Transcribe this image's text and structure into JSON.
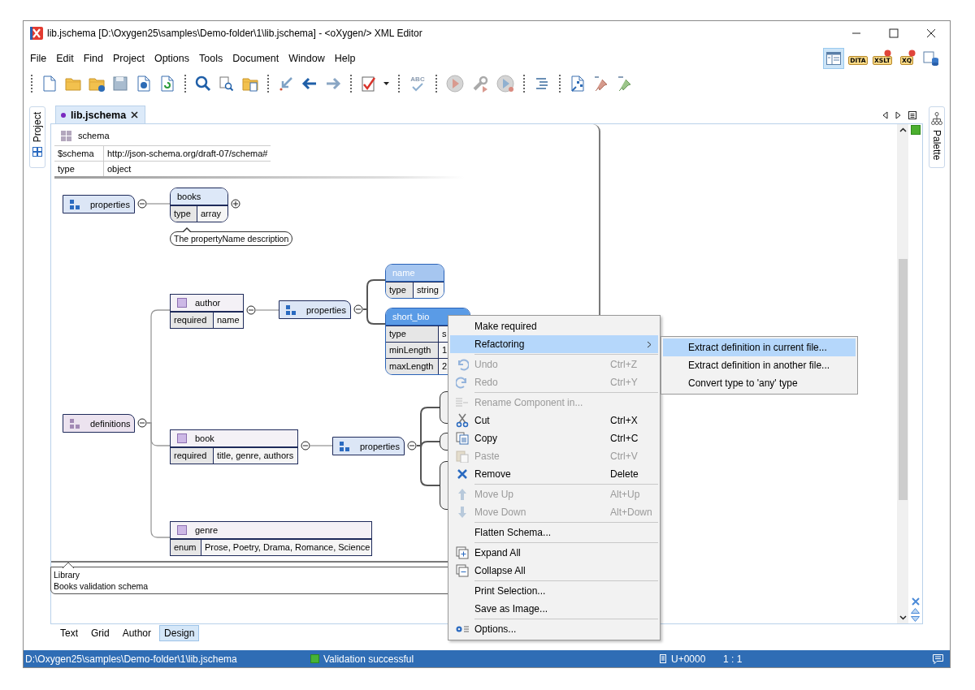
{
  "window": {
    "title": "lib.jschema [D:\\Oxygen25\\samples\\Demo-folder\\1\\lib.jschema] - <oXygen/> XML Editor"
  },
  "menu_bar": [
    "File",
    "Edit",
    "Find",
    "Project",
    "Options",
    "Tools",
    "Document",
    "Window",
    "Help"
  ],
  "perspectives": [
    {
      "kind": "editor",
      "selected": true
    },
    {
      "kind": "badge",
      "label": "DITA",
      "selected": false
    },
    {
      "kind": "debug-badge",
      "label": "XSLT",
      "selected": false
    },
    {
      "kind": "debug-badge",
      "label": "XQ",
      "selected": false
    },
    {
      "kind": "database",
      "selected": false
    }
  ],
  "toolbar": {
    "spell_check_text": "ABC"
  },
  "side_tabs": {
    "left": "Project",
    "right": "Palette"
  },
  "editor_tab": {
    "label": "lib.jschema"
  },
  "schema_header": {
    "title": "schema",
    "rows": [
      [
        "$schema",
        "http://json-schema.org/draft-07/schema#"
      ],
      [
        "type",
        "object"
      ]
    ]
  },
  "nodes": [
    {
      "kind": "properties",
      "label": "properties",
      "expanded": true,
      "children": [
        {
          "kind": "property",
          "label": "books",
          "expanded": false,
          "selected": false,
          "highlighted": false,
          "rows": [
            [
              "type",
              "array"
            ]
          ],
          "comment": "The propertyName description"
        }
      ]
    },
    {
      "kind": "definitions",
      "label": "definitions",
      "expanded": true,
      "children": [
        {
          "kind": "definition",
          "label": "author",
          "expanded": true,
          "selected": false,
          "highlighted": false,
          "rows": [
            [
              "required",
              "name"
            ]
          ],
          "children": [
            {
              "kind": "properties",
              "label": "properties",
              "expanded": true,
              "children": [
                {
                  "kind": "property",
                  "label": "name",
                  "selected": false,
                  "highlighted": true,
                  "rows": [
                    [
                      "type",
                      "string"
                    ]
                  ]
                },
                {
                  "kind": "property",
                  "label": "short_bio",
                  "selected": true,
                  "highlighted": false,
                  "rows": [
                    [
                      "type",
                      "s"
                    ],
                    [
                      "minLength",
                      "1"
                    ],
                    [
                      "maxLength",
                      "2"
                    ]
                  ]
                }
              ]
            }
          ]
        },
        {
          "kind": "definition",
          "label": "book",
          "expanded": true,
          "selected": false,
          "highlighted": false,
          "rows": [
            [
              "required",
              "title, genre, authors"
            ]
          ],
          "children": [
            {
              "kind": "properties",
              "label": "properties",
              "expanded": true,
              "children": [
                {
                  "kind": "obscured"
                },
                {
                  "kind": "obscured"
                },
                {
                  "kind": "obscured"
                }
              ]
            }
          ]
        },
        {
          "kind": "definition",
          "label": "genre",
          "selected": false,
          "highlighted": false,
          "rows": [
            [
              "enum",
              "Prose, Poetry, Drama, Romance, Science"
            ]
          ]
        }
      ]
    }
  ],
  "annotation": {
    "title": "Library",
    "text": "Books validation schema"
  },
  "view_tabs": [
    {
      "label": "Text",
      "selected": false
    },
    {
      "label": "Grid",
      "selected": false
    },
    {
      "label": "Author",
      "selected": false
    },
    {
      "label": "Design",
      "selected": true
    }
  ],
  "context_menu": {
    "groups": [
      [
        {
          "label": "Make required",
          "disabled": false,
          "selected": false,
          "submenu": false
        },
        {
          "label": "Refactoring",
          "disabled": false,
          "selected": true,
          "submenu": true
        }
      ],
      [
        {
          "label": "Undo",
          "shortcut": "Ctrl+Z",
          "disabled": true,
          "selected": false,
          "submenu": false
        },
        {
          "label": "Redo",
          "shortcut": "Ctrl+Y",
          "disabled": true,
          "selected": false,
          "submenu": false
        }
      ],
      [
        {
          "label": "Rename Component in...",
          "disabled": true,
          "selected": false,
          "submenu": false
        },
        {
          "label": "Cut",
          "shortcut": "Ctrl+X",
          "disabled": false,
          "selected": false,
          "submenu": false
        },
        {
          "label": "Copy",
          "shortcut": "Ctrl+C",
          "disabled": false,
          "selected": false,
          "submenu": false
        },
        {
          "label": "Paste",
          "shortcut": "Ctrl+V",
          "disabled": true,
          "selected": false,
          "submenu": false
        },
        {
          "label": "Remove",
          "shortcut": "Delete",
          "disabled": false,
          "selected": false,
          "submenu": false
        }
      ],
      [
        {
          "label": "Move Up",
          "shortcut": "Alt+Up",
          "disabled": true,
          "selected": false,
          "submenu": false
        },
        {
          "label": "Move Down",
          "shortcut": "Alt+Down",
          "disabled": true,
          "selected": false,
          "submenu": false
        }
      ],
      [
        {
          "label": "Flatten Schema...",
          "disabled": false,
          "selected": false,
          "submenu": false
        }
      ],
      [
        {
          "label": "Expand All",
          "disabled": false,
          "selected": false,
          "submenu": false
        },
        {
          "label": "Collapse All",
          "disabled": false,
          "selected": false,
          "submenu": false
        }
      ],
      [
        {
          "label": "Print Selection...",
          "disabled": false,
          "selected": false,
          "submenu": false
        },
        {
          "label": "Save as Image...",
          "disabled": false,
          "selected": false,
          "submenu": false
        }
      ],
      [
        {
          "label": "Options...",
          "disabled": false,
          "selected": false,
          "submenu": false
        }
      ]
    ]
  },
  "submenu": [
    {
      "label": "Extract definition in current file...",
      "selected": true
    },
    {
      "label": "Extract definition in another file...",
      "selected": false
    },
    {
      "label": "Convert type to 'any' type",
      "selected": false
    }
  ],
  "status_bar": {
    "path": "D:\\Oxygen25\\samples\\Demo-folder\\1\\lib.jschema",
    "validation": "Validation successful",
    "encoding": "U+0000",
    "position": "1 : 1"
  }
}
